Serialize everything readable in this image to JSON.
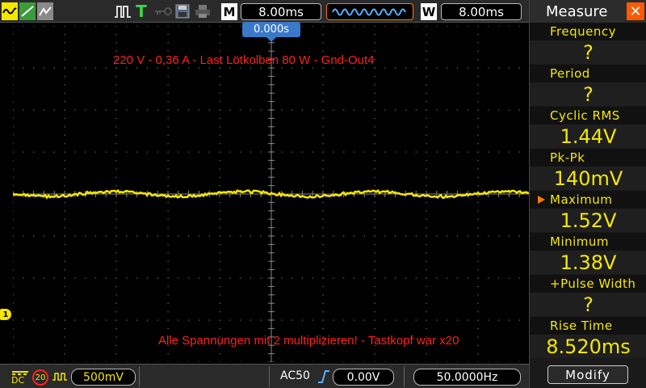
{
  "toolbar": {
    "mode_letter": "M",
    "timebase": "8.00ms",
    "window_letter": "W",
    "window_timebase": "8.00ms"
  },
  "trigger": {
    "position": "0.000s"
  },
  "channel": {
    "number": "1",
    "coupling": "DC",
    "bw_limit": "20",
    "volts_per_div": "500mV"
  },
  "annotations": {
    "top_note": "220 V - 0,36 A - Last Lötkolben 80 W - Gnd-Out4",
    "bottom_note": "Alle Spannungen mit 2 multiplizieren! - Tastkopf war x20"
  },
  "trigger_status": {
    "source": "AC50",
    "level": "0.00V",
    "frequency": "50.0000Hz"
  },
  "measure_panel": {
    "title": "Measure",
    "items": [
      {
        "label": "Frequency",
        "value": "?"
      },
      {
        "label": "Period",
        "value": "?"
      },
      {
        "label": "Cyclic RMS",
        "value": "1.44V"
      },
      {
        "label": "Pk-Pk",
        "value": "140mV"
      },
      {
        "label": "Maximum",
        "value": "1.52V"
      },
      {
        "label": "Minimum",
        "value": "1.38V"
      },
      {
        "label": "+Pulse Width",
        "value": "?"
      },
      {
        "label": "Rise Time",
        "value": "8.520ms"
      }
    ],
    "modify_label": "Modify"
  },
  "colors": {
    "trace": "#f5e800",
    "annotation": "#ff2020",
    "measure_text": "#f5e800",
    "trigger_marker": "#3a78c8",
    "close_button": "#ff5a00"
  }
}
